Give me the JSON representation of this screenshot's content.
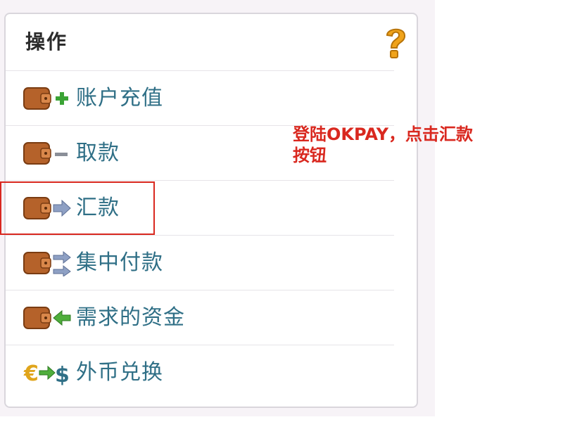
{
  "panel": {
    "title": "操作"
  },
  "menu": {
    "items": [
      {
        "label": "账户充值",
        "icon": "wallet-plus-icon"
      },
      {
        "label": "取款",
        "icon": "wallet-minus-icon"
      },
      {
        "label": "汇款",
        "icon": "wallet-arrow-right-icon"
      },
      {
        "label": "集中付款",
        "icon": "wallet-exchange-icon"
      },
      {
        "label": "需求的资金",
        "icon": "wallet-arrow-left-icon"
      },
      {
        "label": "外币兑换",
        "icon": "euro-dollar-exchange-icon"
      }
    ]
  },
  "annotation": {
    "line1": "登陆OKPAY，点击汇款",
    "line2": "按钮"
  },
  "colors": {
    "label": "#2f6f86",
    "highlight": "#d9281f",
    "wallet": "#b5622a",
    "help": "#f0a31a"
  }
}
